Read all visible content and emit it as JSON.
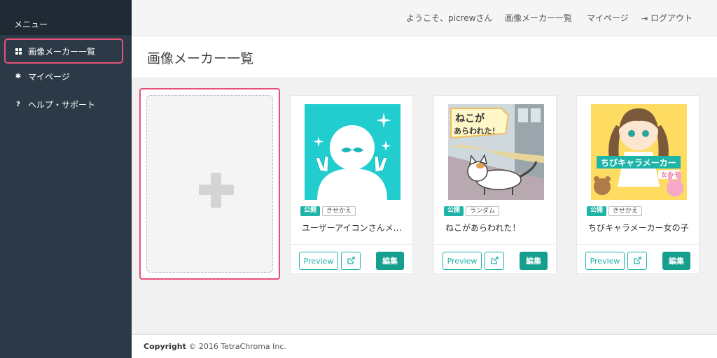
{
  "sidebar": {
    "header": "メニュー",
    "items": [
      {
        "label": "画像メーカー一覧",
        "icon": "grid-icon",
        "active": true
      },
      {
        "label": "マイページ",
        "icon": "gear-icon",
        "active": false
      },
      {
        "label": "ヘルプ・サポート",
        "icon": "question-icon",
        "active": false
      }
    ]
  },
  "topnav": {
    "welcome": "ようこそ、picrewさん",
    "makers": "画像メーカー一覧",
    "mypage": "マイページ",
    "logout": "ログアウト"
  },
  "page_title": "画像メーカー一覧",
  "cards": [
    {
      "status": "公開",
      "tag": "きせかえ",
      "name": "ユーザーアイコンさんメ…",
      "preview": "Preview",
      "edit": "編集"
    },
    {
      "status": "公開",
      "tag": "ランダム",
      "name": "ねこがあらわれた！",
      "preview": "Preview",
      "edit": "編集",
      "image_text": [
        "ねこが",
        "あらわれた！"
      ]
    },
    {
      "status": "公開",
      "tag": "きせかえ",
      "name": "ちびキャラメーカー女の子",
      "preview": "Preview",
      "edit": "編集",
      "image_text": [
        "ちびキャラメーカー",
        "女の子"
      ]
    }
  ],
  "footer": {
    "copyright_label": "Copyright",
    "copyright_text": "© 2016 TetraChroma Inc."
  },
  "colors": {
    "accent": "#1eb4a8",
    "highlight": "#e8507a",
    "sidebar": "#2c3a47"
  }
}
